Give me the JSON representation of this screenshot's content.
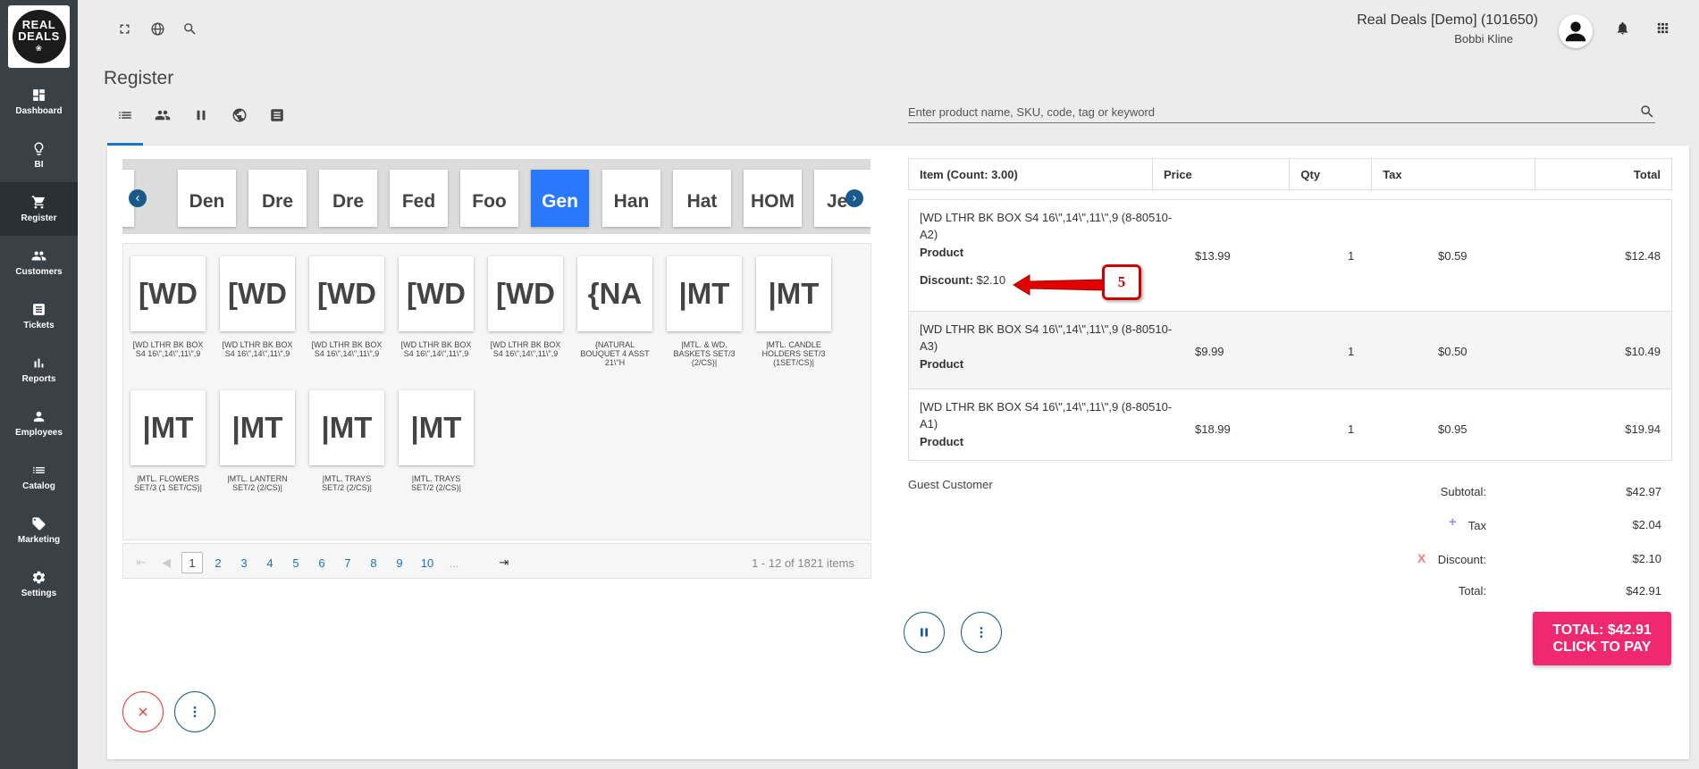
{
  "brand": {
    "logo_line1": "REAL",
    "logo_line2": "DEALS"
  },
  "sidebar": {
    "items": [
      {
        "label": "Dashboard",
        "icon": "dashboard-icon"
      },
      {
        "label": "BI",
        "icon": "lightbulb-icon"
      },
      {
        "label": "Register",
        "icon": "cart-icon"
      },
      {
        "label": "Customers",
        "icon": "people-icon"
      },
      {
        "label": "Tickets",
        "icon": "ticket-icon"
      },
      {
        "label": "Reports",
        "icon": "bar-chart-icon"
      },
      {
        "label": "Employees",
        "icon": "person-icon"
      },
      {
        "label": "Catalog",
        "icon": "list-icon"
      },
      {
        "label": "Marketing",
        "icon": "tag-icon"
      },
      {
        "label": "Settings",
        "icon": "gear-icon"
      }
    ],
    "active": "Register"
  },
  "header": {
    "company": "Real Deals [Demo] (101650)",
    "user": "Bobbi Kline"
  },
  "page": {
    "title": "Register"
  },
  "search": {
    "placeholder": "Enter product name, SKU, code, tag or keyword"
  },
  "categories": [
    "",
    "Den",
    "Dre",
    "Dre",
    "Fed",
    "Foo",
    "Gen",
    "Han",
    "Hat",
    "HOM",
    "Je"
  ],
  "active_category": "Gen",
  "products": [
    {
      "tile": "[WD",
      "name": "[WD LTHR BK BOX S4 16\\\",14\\\",11\\\",9"
    },
    {
      "tile": "[WD",
      "name": "[WD LTHR BK BOX S4 16\\\",14\\\",11\\\",9"
    },
    {
      "tile": "[WD",
      "name": "[WD LTHR BK BOX S4 16\\\",14\\\",11\\\",9"
    },
    {
      "tile": "[WD",
      "name": "[WD LTHR BK BOX S4 16\\\",14\\\",11\\\",9"
    },
    {
      "tile": "[WD",
      "name": "[WD LTHR BK BOX S4 16\\\",14\\\",11\\\",9"
    },
    {
      "tile": "{NA",
      "name": "{NATURAL BOUQUET 4 ASST 21\\\"H"
    },
    {
      "tile": "|MT",
      "name": "|MTL. & WD. BASKETS SET/3 (2/CS)|"
    },
    {
      "tile": "|MT",
      "name": "|MTL. CANDLE HOLDERS SET/3 (1SET/CS)|"
    },
    {
      "tile": "|MT",
      "name": "|MTL. FLOWERS SET/3 (1 SET/CS)|"
    },
    {
      "tile": "|MT",
      "name": "|MTL. LANTERN SET/2 (2/CS)|"
    },
    {
      "tile": "|MT",
      "name": "|MTL. TRAYS SET/2 (2/CS)|"
    },
    {
      "tile": "|MT",
      "name": "|MTL. TRAYS SET/2 (2/CS)|"
    }
  ],
  "pager": {
    "pages": [
      "1",
      "2",
      "3",
      "4",
      "5",
      "6",
      "7",
      "8",
      "9",
      "10",
      "..."
    ],
    "current": "1",
    "info": "1 - 12 of 1821 items"
  },
  "cart": {
    "headers": {
      "item": "Item (Count: 3.00)",
      "price": "Price",
      "qty": "Qty",
      "tax": "Tax",
      "total": "Total"
    },
    "rows": [
      {
        "desc": "[WD LTHR BK BOX S4 16\\\",14\\\",11\\\",9 (8-80510-A2)",
        "type": "Product",
        "discount_label": "Discount:",
        "discount": "$2.10",
        "price": "$13.99",
        "qty": "1",
        "tax": "$0.59",
        "total": "$12.48"
      },
      {
        "desc": "[WD LTHR BK BOX S4 16\\\",14\\\",11\\\",9 (8-80510-A3)",
        "type": "Product",
        "price": "$9.99",
        "qty": "1",
        "tax": "$0.50",
        "total": "$10.49"
      },
      {
        "desc": "[WD LTHR BK BOX S4 16\\\",14\\\",11\\\",9 (8-80510-A1)",
        "type": "Product",
        "price": "$18.99",
        "qty": "1",
        "tax": "$0.95",
        "total": "$19.94"
      }
    ]
  },
  "annotation": {
    "badge": "5"
  },
  "customer": {
    "name": "Guest Customer"
  },
  "summary": {
    "subtotal_label": "Subtotal:",
    "subtotal": "$42.97",
    "tax_label": "Tax",
    "tax": "$2.04",
    "discount_label": "Discount:",
    "discount": "$2.10",
    "total_label": "Total:",
    "total": "$42.91"
  },
  "pay": {
    "line1": "TOTAL: $42.91",
    "line2": "CLICK TO PAY"
  },
  "colors": {
    "sidebar": "#3a4146",
    "accent": "#2979ff",
    "pay": "#f0296e",
    "cancel": "#e53935",
    "link": "#1a73c8"
  }
}
